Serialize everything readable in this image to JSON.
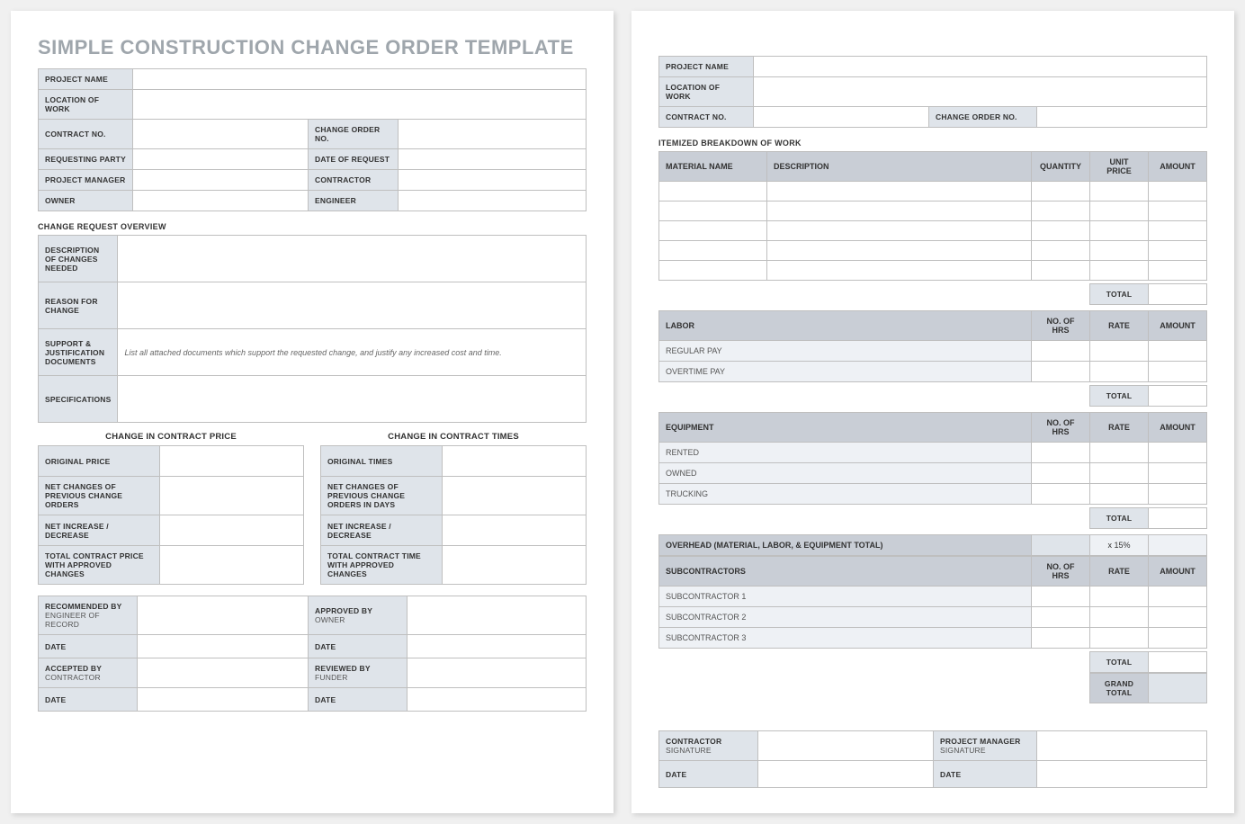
{
  "title": "SIMPLE CONSTRUCTION CHANGE ORDER TEMPLATE",
  "p1": {
    "info_rows": [
      [
        {
          "l": "PROJECT NAME"
        }
      ],
      [
        {
          "l": "LOCATION OF WORK"
        }
      ],
      [
        {
          "l": "CONTRACT NO."
        },
        {
          "l": "CHANGE ORDER NO."
        }
      ],
      [
        {
          "l": "REQUESTING PARTY"
        },
        {
          "l": "DATE OF REQUEST"
        }
      ],
      [
        {
          "l": "PROJECT MANAGER"
        },
        {
          "l": "CONTRACTOR"
        }
      ],
      [
        {
          "l": "OWNER"
        },
        {
          "l": "ENGINEER"
        }
      ]
    ],
    "overview_title": "CHANGE REQUEST OVERVIEW",
    "overview_rows": [
      {
        "l": "DESCRIPTION OF CHANGES NEEDED",
        "hint": ""
      },
      {
        "l": "REASON FOR CHANGE",
        "hint": ""
      },
      {
        "l": "SUPPORT & JUSTIFICATION DOCUMENTS",
        "hint": "List all attached documents which support the requested change, and justify any increased cost and time."
      },
      {
        "l": "SPECIFICATIONS",
        "hint": ""
      }
    ],
    "price_title": "CHANGE IN CONTRACT PRICE",
    "price_rows": [
      "ORIGINAL PRICE",
      "NET CHANGES OF PREVIOUS CHANGE ORDERS",
      "NET INCREASE / DECREASE",
      "TOTAL CONTRACT PRICE WITH APPROVED CHANGES"
    ],
    "time_title": "CHANGE IN CONTRACT TIMES",
    "time_rows": [
      "ORIGINAL TIMES",
      "NET CHANGES OF PREVIOUS CHANGE ORDERS IN DAYS",
      "NET INCREASE / DECREASE",
      "TOTAL CONTRACT TIME WITH APPROVED CHANGES"
    ],
    "sig_left": [
      {
        "t": "RECOMMENDED BY",
        "s": "ENGINEER OF RECORD"
      },
      {
        "t": "DATE"
      },
      {
        "t": "ACCEPTED BY",
        "s": "CONTRACTOR"
      },
      {
        "t": "DATE"
      }
    ],
    "sig_right": [
      {
        "t": "APPROVED BY",
        "s": "OWNER"
      },
      {
        "t": "DATE"
      },
      {
        "t": "REVIEWED BY",
        "s": "FUNDER"
      },
      {
        "t": "DATE"
      }
    ]
  },
  "p2": {
    "info_rows": [
      [
        {
          "l": "PROJECT NAME"
        }
      ],
      [
        {
          "l": "LOCATION OF WORK"
        }
      ],
      [
        {
          "l": "CONTRACT NO."
        },
        {
          "l": "CHANGE ORDER NO."
        }
      ]
    ],
    "itemized_title": "ITEMIZED BREAKDOWN OF WORK",
    "material_headers": [
      "MATERIAL NAME",
      "DESCRIPTION",
      "QUANTITY",
      "UNIT PRICE",
      "AMOUNT"
    ],
    "material_row_count": 5,
    "labor": {
      "title": "LABOR",
      "cols": [
        "NO. OF HRS",
        "RATE",
        "AMOUNT"
      ],
      "rows": [
        "REGULAR PAY",
        "OVERTIME PAY"
      ]
    },
    "equipment": {
      "title": "EQUIPMENT",
      "cols": [
        "NO. OF HRS",
        "RATE",
        "AMOUNT"
      ],
      "rows": [
        "RENTED",
        "OWNED",
        "TRUCKING"
      ]
    },
    "overhead": {
      "label": "OVERHEAD (MATERIAL, LABOR, & EQUIPMENT TOTAL)",
      "rate": "x 15%"
    },
    "subs": {
      "title": "SUBCONTRACTORS",
      "cols": [
        "NO. OF HRS",
        "RATE",
        "AMOUNT"
      ],
      "rows": [
        "SUBCONTRACTOR 1",
        "SUBCONTRACTOR 2",
        "SUBCONTRACTOR 3"
      ]
    },
    "total_label": "TOTAL",
    "grand_total": "GRAND TOTAL",
    "sig": [
      {
        "left_t": "CONTRACTOR",
        "left_s": "SIGNATURE",
        "right_t": "PROJECT MANAGER",
        "right_s": "SIGNATURE"
      },
      {
        "left_t": "DATE",
        "right_t": "DATE"
      }
    ]
  }
}
